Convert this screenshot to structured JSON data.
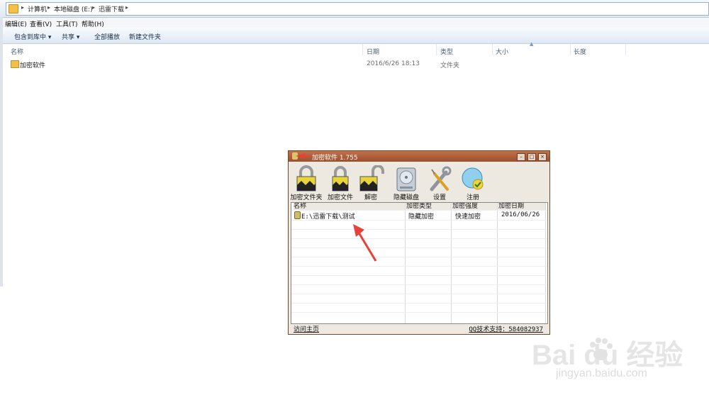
{
  "breadcrumb": {
    "items": [
      "计算机",
      "本地磁盘 (E:)",
      "迅雷下载"
    ]
  },
  "menu": [
    "编辑(E)",
    "查看(V)",
    "工具(T)",
    "帮助(H)"
  ],
  "toolbar": {
    "include": "包含到库中 ▾",
    "share": "共享 ▾",
    "playall": "全部播放",
    "newfolder": "新建文件夹"
  },
  "columns": [
    "名称",
    "日期",
    "类型",
    "大小",
    "长度"
  ],
  "files": [
    {
      "name": "加密软件",
      "date": "2016/6/26 18:13",
      "type": "文件夹"
    }
  ],
  "dialog": {
    "title": "加密软件 1.755",
    "tools": [
      "加密文件夹",
      "加密文件",
      "解密",
      "隐藏磁盘",
      "设置",
      "注册"
    ],
    "list_headers": [
      "名称",
      "加密类型",
      "加密强度",
      "加密日期"
    ],
    "rows": [
      {
        "name": "E:\\迅雷下载\\测试",
        "type": "隐藏加密",
        "strength": "快速加密",
        "date": "2016/06/26"
      }
    ],
    "status_left": "访问主页",
    "status_right": "QQ技术支持：584082937"
  },
  "watermark": {
    "brand": "Bai du 经验",
    "url": "jingyan.baidu.com"
  },
  "colors": {
    "dialog_title": "#a95a36",
    "arrow": "#e8413a"
  }
}
